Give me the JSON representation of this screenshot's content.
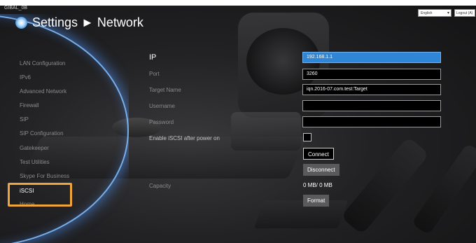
{
  "header": {
    "app_id": "GIBAL_0B",
    "title": "Settings ► Network",
    "language": "English",
    "logout": "Logout (A)"
  },
  "sidebar": {
    "items": [
      {
        "label": "LAN Configuration",
        "active": false
      },
      {
        "label": "IPv6",
        "active": false
      },
      {
        "label": "Advanced Network",
        "active": false
      },
      {
        "label": "Firewall",
        "active": false
      },
      {
        "label": "SIP",
        "active": false
      },
      {
        "label": "SIP Configuration",
        "active": false
      },
      {
        "label": "Gatekeeper",
        "active": false
      },
      {
        "label": "Test Utilities",
        "active": false
      },
      {
        "label": "Skype For Business",
        "active": false
      },
      {
        "label": "iSCSI",
        "active": true
      },
      {
        "label": "Home",
        "active": false
      }
    ]
  },
  "form": {
    "heading": "IP",
    "ip_value": "192.168.1.1",
    "port_label": "Port",
    "port_value": "3260",
    "target_name_label": "Target Name",
    "target_name_value": "iqn.2016-07.com.test:Target",
    "username_label": "Username",
    "username_value": "",
    "password_label": "Password",
    "password_value": "",
    "enable_label": "Enable iSCSI after power on",
    "enable_checked": false,
    "connect_label": "Connect",
    "disconnect_label": "Disconnect",
    "capacity_label": "Capacity",
    "capacity_value": "0 MB/ 0 MB",
    "format_label": "Format"
  },
  "colors": {
    "accent": "#2f86d6",
    "highlight": "#f0a53c",
    "background": "#1c1c1e"
  }
}
